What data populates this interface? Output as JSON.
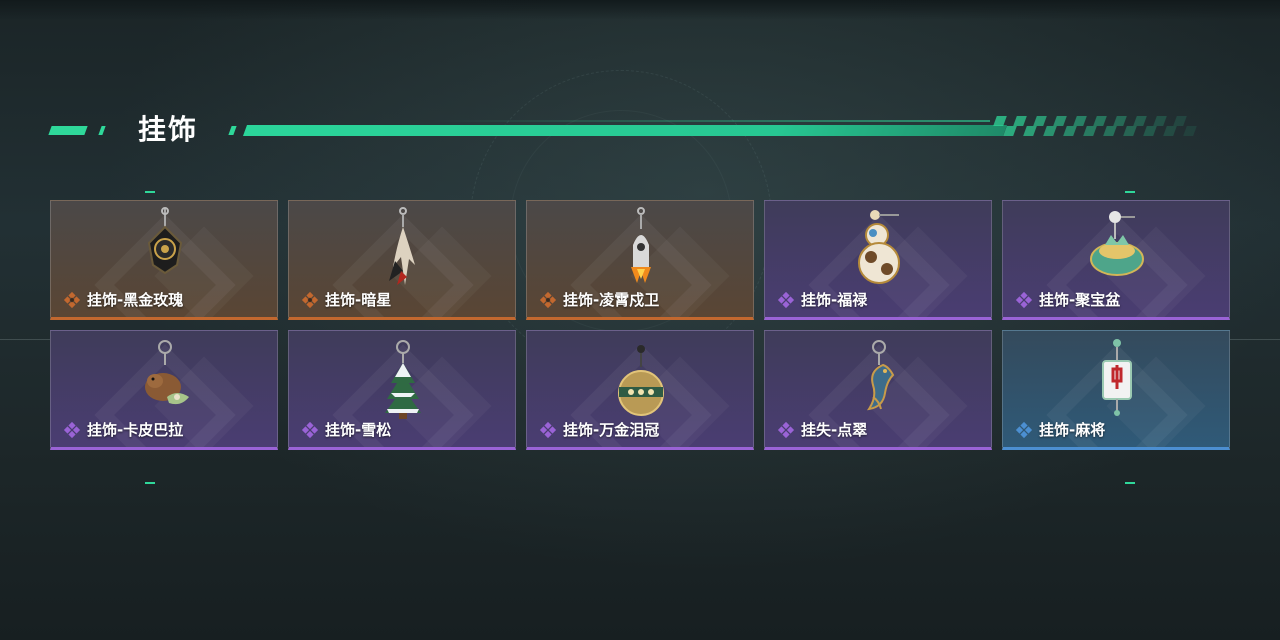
{
  "section": {
    "title": "挂饰"
  },
  "colors": {
    "accent": "#2fd89a",
    "rarity_orange": "#c2682f",
    "rarity_purple": "#9a63d6",
    "rarity_blue": "#4c8fd1"
  },
  "items": [
    {
      "label": "挂饰-黑金玫瑰",
      "rarity": "orange",
      "icon": "black-gold-rose-icon"
    },
    {
      "label": "挂饰-暗星",
      "rarity": "orange",
      "icon": "dark-star-icon"
    },
    {
      "label": "挂饰-凌霄戍卫",
      "rarity": "orange",
      "icon": "sky-guard-icon"
    },
    {
      "label": "挂饰-福禄",
      "rarity": "purple",
      "icon": "gourd-icon"
    },
    {
      "label": "挂饰-聚宝盆",
      "rarity": "purple",
      "icon": "treasure-bowl-icon"
    },
    {
      "label": "挂饰-卡皮巴拉",
      "rarity": "purple",
      "icon": "capybara-icon"
    },
    {
      "label": "挂饰-雪松",
      "rarity": "purple",
      "icon": "snow-pine-icon"
    },
    {
      "label": "挂饰-万金泪冠",
      "rarity": "purple",
      "icon": "golden-crown-icon"
    },
    {
      "label": "挂失-点翠",
      "rarity": "purple",
      "icon": "kingfisher-icon"
    },
    {
      "label": "挂饰-麻将",
      "rarity": "blue",
      "icon": "mahjong-tile-icon"
    }
  ]
}
